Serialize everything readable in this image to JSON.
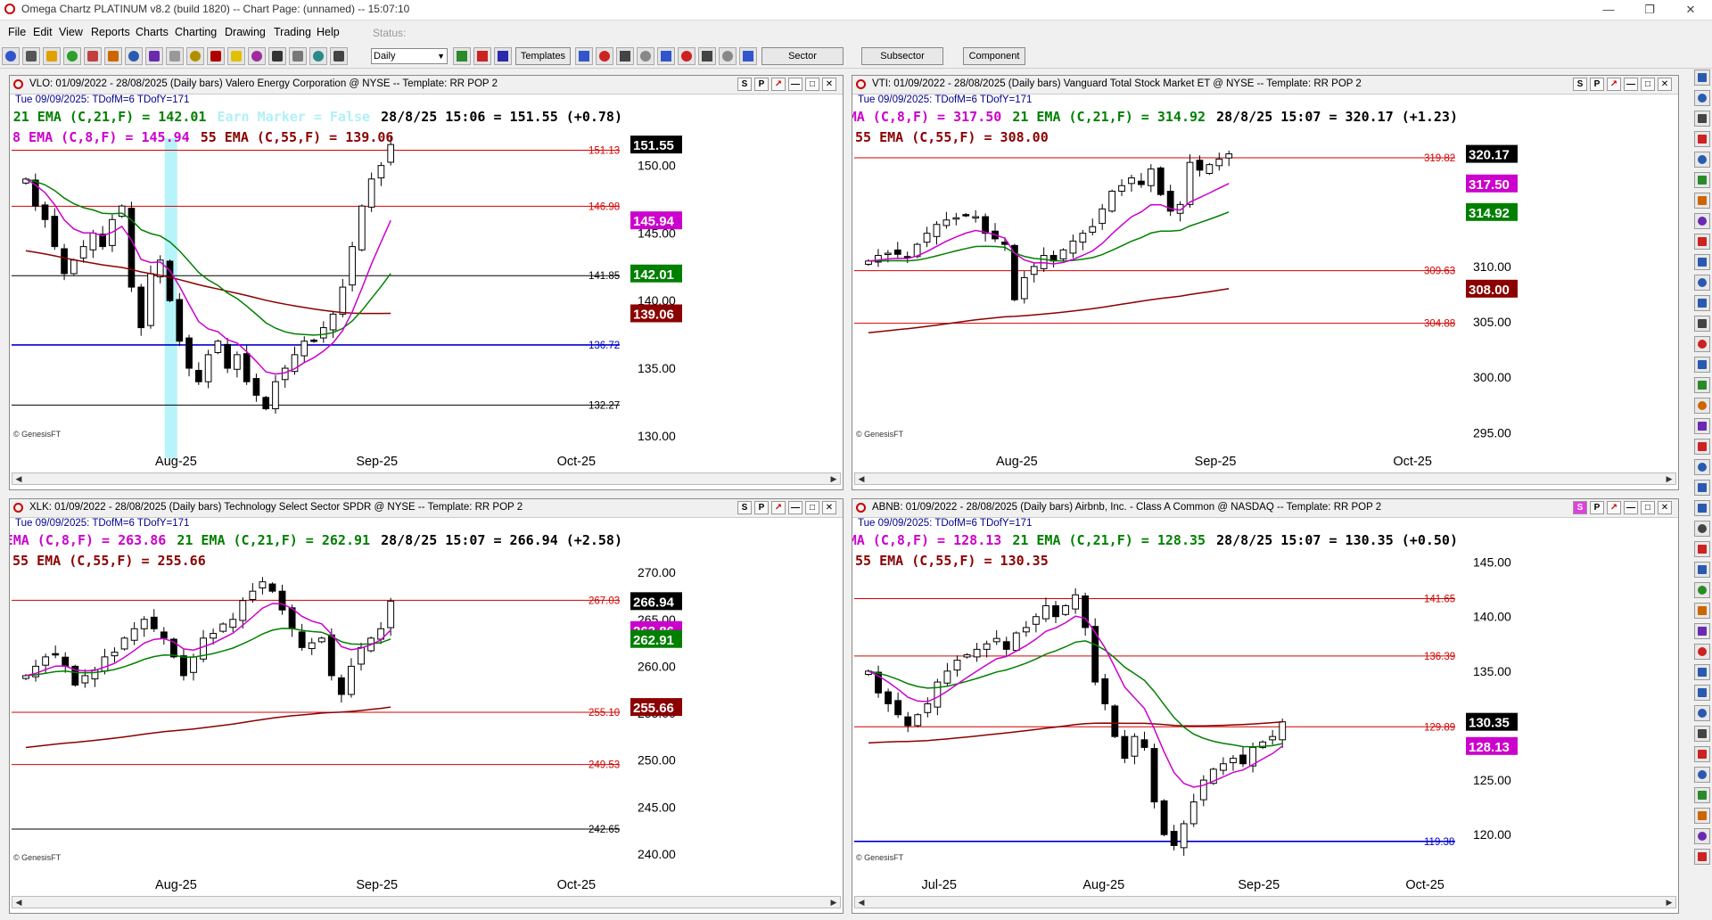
{
  "window": {
    "title": "Omega Chartz PLATINUM v8.2 (build 1820)  --  Chart Page: (unnamed) -- 15:07:10"
  },
  "menu": [
    "File",
    "Edit",
    "View",
    "Reports",
    "Charts",
    "Charting",
    "Drawing",
    "Trading",
    "Help"
  ],
  "status_label": "Status:",
  "toolbar": {
    "interval": "Daily",
    "templates": "Templates",
    "sector": "Sector",
    "subsector": "Subsector",
    "component": "Component"
  },
  "panels": [
    {
      "id": "vlo",
      "title": "VLO: 01/09/2022 - 28/08/2025  (Daily bars)   Valero Energy Corporation @ NYSE  --  Template: RR POP 2",
      "date_line": "Tue  09/09/2025:  TDofM=6  TDofY=171",
      "line1": [
        {
          "text": "21 EMA (C,21,F) = 142.01",
          "color": "#008000"
        },
        {
          "text": "Earn Marker = False",
          "color": "#b0f0f8"
        },
        {
          "text": "28/8/25 15:06 = 151.55 (+0.78)",
          "color": "#000000"
        }
      ],
      "line2": [
        {
          "text": "8 EMA (C,8,F) = 145.94",
          "color": "#cc00cc"
        },
        {
          "text": "55 EMA (C,55,F) = 139.06",
          "color": "#8b0000"
        }
      ],
      "axis_labels": [
        "150.00",
        "145.00",
        "140.00",
        "135.00",
        "130.00"
      ],
      "hlines": [
        {
          "label": "151.13",
          "color": "#d40000"
        },
        {
          "label": "146.98",
          "color": "#d40000"
        },
        {
          "label": "141.85",
          "color": "#000000"
        },
        {
          "label": "136.72",
          "color": "#0000cc"
        },
        {
          "label": "132.27",
          "color": "#000000"
        }
      ],
      "badges": [
        {
          "text": "151.55",
          "bg": "#000000"
        },
        {
          "text": "145.94",
          "bg": "#cc00cc"
        },
        {
          "text": "142.01",
          "bg": "#008000"
        },
        {
          "text": "139.06",
          "bg": "#8b0000"
        }
      ],
      "x_labels": [
        "Aug-25",
        "Sep-25",
        "Oct-25"
      ],
      "source": "© GenesisFT"
    },
    {
      "id": "vti",
      "title": "VTI: 01/09/2022 - 28/08/2025  (Daily bars)   Vanguard Total Stock Market ET @ NYSE  --  Template: RR POP 2",
      "date_line": "Tue  09/09/2025:  TDofM=6  TDofY=171",
      "line1": [
        {
          "text": "8 EMA (C,8,F) = 317.50",
          "color": "#cc00cc"
        },
        {
          "text": "21 EMA (C,21,F) = 314.92",
          "color": "#008000"
        },
        {
          "text": "28/8/25 15:07 = 320.17 (+1.23)",
          "color": "#000000"
        }
      ],
      "line2": [
        {
          "text": "55 EMA (C,55,F) = 308.00",
          "color": "#8b0000"
        }
      ],
      "axis_labels": [
        "310.00",
        "305.00",
        "300.00",
        "295.00"
      ],
      "hlines": [
        {
          "label": "319.82",
          "color": "#d40000"
        },
        {
          "label": "309.63",
          "color": "#d40000"
        },
        {
          "label": "304.88",
          "color": "#d40000"
        }
      ],
      "badges": [
        {
          "text": "320.17",
          "bg": "#000000"
        },
        {
          "text": "317.50",
          "bg": "#cc00cc"
        },
        {
          "text": "314.92",
          "bg": "#008000"
        },
        {
          "text": "308.00",
          "bg": "#8b0000"
        }
      ],
      "x_labels": [
        "Aug-25",
        "Sep-25",
        "Oct-25"
      ],
      "source": "© GenesisFT"
    },
    {
      "id": "xlk",
      "title": "XLK: 01/09/2022 - 28/08/2025  (Daily bars)   Technology Select Sector SPDR @ NYSE  --  Template: RR POP 2",
      "date_line": "Tue  09/09/2025:  TDofM=6  TDofY=171",
      "line1": [
        {
          "text": "8 EMA (C,8,F) = 263.86",
          "color": "#cc00cc"
        },
        {
          "text": "21 EMA (C,21,F) = 262.91",
          "color": "#008000"
        },
        {
          "text": "28/8/25 15:07 = 266.94 (+2.58)",
          "color": "#000000"
        }
      ],
      "line2": [
        {
          "text": "55 EMA (C,55,F) = 255.66",
          "color": "#8b0000"
        }
      ],
      "axis_labels": [
        "270.00",
        "265.00",
        "260.00",
        "255.00",
        "250.00",
        "245.00",
        "240.00"
      ],
      "hlines": [
        {
          "label": "267.03",
          "color": "#d40000"
        },
        {
          "label": "255.10",
          "color": "#d40000"
        },
        {
          "label": "249.53",
          "color": "#d40000"
        },
        {
          "label": "242.65",
          "color": "#000000"
        }
      ],
      "badges": [
        {
          "text": "266.94",
          "bg": "#000000"
        },
        {
          "text": "263.86",
          "bg": "#cc00cc"
        },
        {
          "text": "262.91",
          "bg": "#008000"
        },
        {
          "text": "255.66",
          "bg": "#8b0000"
        }
      ],
      "x_labels": [
        "Aug-25",
        "Sep-25",
        "Oct-25"
      ],
      "source": "© GenesisFT"
    },
    {
      "id": "abnb",
      "title": "ABNB: 01/09/2022 - 28/08/2025  (Daily bars)   Airbnb, Inc. - Class A Common @ NASDAQ  --  Template: RR POP 2",
      "date_line": "Tue  09/09/2025:  TDofM=6  TDofY=171",
      "line1": [
        {
          "text": "8 EMA (C,8,F) = 128.13",
          "color": "#cc00cc"
        },
        {
          "text": "21 EMA (C,21,F) = 128.35",
          "color": "#008000"
        },
        {
          "text": "28/8/25 15:07 = 130.35 (+0.50)",
          "color": "#000000"
        }
      ],
      "line2": [
        {
          "text": "55 EMA (C,55,F) = 130.35",
          "color": "#8b0000"
        }
      ],
      "axis_labels": [
        "145.00",
        "140.00",
        "135.00",
        "125.00",
        "120.00"
      ],
      "hlines": [
        {
          "label": "141.65",
          "color": "#d40000"
        },
        {
          "label": "136.39",
          "color": "#d40000"
        },
        {
          "label": "129.89",
          "color": "#d40000"
        },
        {
          "label": "119.38",
          "color": "#0000cc"
        }
      ],
      "badges": [
        {
          "text": "130.35",
          "bg": "#000000"
        },
        {
          "text": "128.13",
          "bg": "#cc00cc"
        }
      ],
      "x_labels": [
        "Jul-25",
        "Aug-25",
        "Sep-25",
        "Oct-25"
      ],
      "source": "© GenesisFT"
    }
  ],
  "chart_data": [
    {
      "type": "candlestick",
      "symbol": "VLO",
      "ylim": [
        129,
        154
      ],
      "closes": [
        149,
        147,
        146,
        144,
        142,
        143,
        144,
        145,
        144,
        146,
        147,
        141,
        138,
        142,
        143,
        140,
        137,
        135,
        134,
        136,
        137,
        135,
        136,
        134,
        133,
        132,
        134,
        135,
        136,
        137,
        137,
        138,
        139,
        141,
        144,
        147,
        149,
        150,
        151.55
      ],
      "ema8_end": 145.94,
      "ema21_end": 142.01,
      "ema55_end": 139.06,
      "hlines": [
        151.13,
        146.98,
        141.85,
        136.72,
        132.27
      ],
      "earn_marker_index": 15
    },
    {
      "type": "candlestick",
      "symbol": "VTI",
      "ylim": [
        293.5,
        324
      ],
      "closes": [
        310.5,
        311,
        311.2,
        311.1,
        310.9,
        312,
        313,
        313.8,
        314.2,
        314.4,
        314.6,
        314.5,
        313,
        312.5,
        312,
        307,
        309,
        310,
        311,
        310.5,
        311.5,
        312.3,
        313,
        313.6,
        315.2,
        316.8,
        317.3,
        318,
        317.4,
        318.8,
        316.5,
        315,
        315.6,
        319.4,
        318.7,
        319.2,
        319.7,
        320.17
      ],
      "ema8_end": 317.5,
      "ema21_end": 314.92,
      "ema55_end": 308.0,
      "hlines": [
        319.82,
        309.63,
        304.88
      ]
    },
    {
      "type": "candlestick",
      "symbol": "XLK",
      "ylim": [
        238,
        274
      ],
      "closes": [
        259,
        260,
        261,
        261.2,
        260,
        258,
        259,
        259.6,
        261,
        261.5,
        263,
        264,
        265,
        264,
        263,
        261,
        259,
        261,
        263,
        263.5,
        264.5,
        265,
        267,
        268,
        269,
        268,
        266,
        264,
        262,
        262.5,
        263,
        259,
        257,
        260,
        262,
        263,
        264,
        266.94
      ],
      "ema8_end": 263.86,
      "ema21_end": 262.91,
      "ema55_end": 255.66,
      "hlines": [
        267.03,
        255.1,
        249.53,
        242.65
      ]
    },
    {
      "type": "candlestick",
      "symbol": "ABNB",
      "ylim": [
        116.5,
        147.5
      ],
      "closes": [
        135,
        133,
        132,
        131,
        130,
        131,
        132,
        134,
        135,
        136,
        136.5,
        137,
        137.5,
        138,
        137,
        138.5,
        139,
        140,
        141,
        140,
        141,
        142,
        139,
        134,
        132,
        129,
        127,
        129,
        128,
        123,
        120,
        119,
        121,
        123,
        125,
        126,
        126.5,
        127,
        126.5,
        128,
        128.5,
        129,
        130.35
      ],
      "ema8_end": 128.13,
      "ema21_end": 128.35,
      "ema55_end": 130.35,
      "hlines": [
        141.65,
        136.39,
        129.89,
        119.38
      ]
    }
  ]
}
